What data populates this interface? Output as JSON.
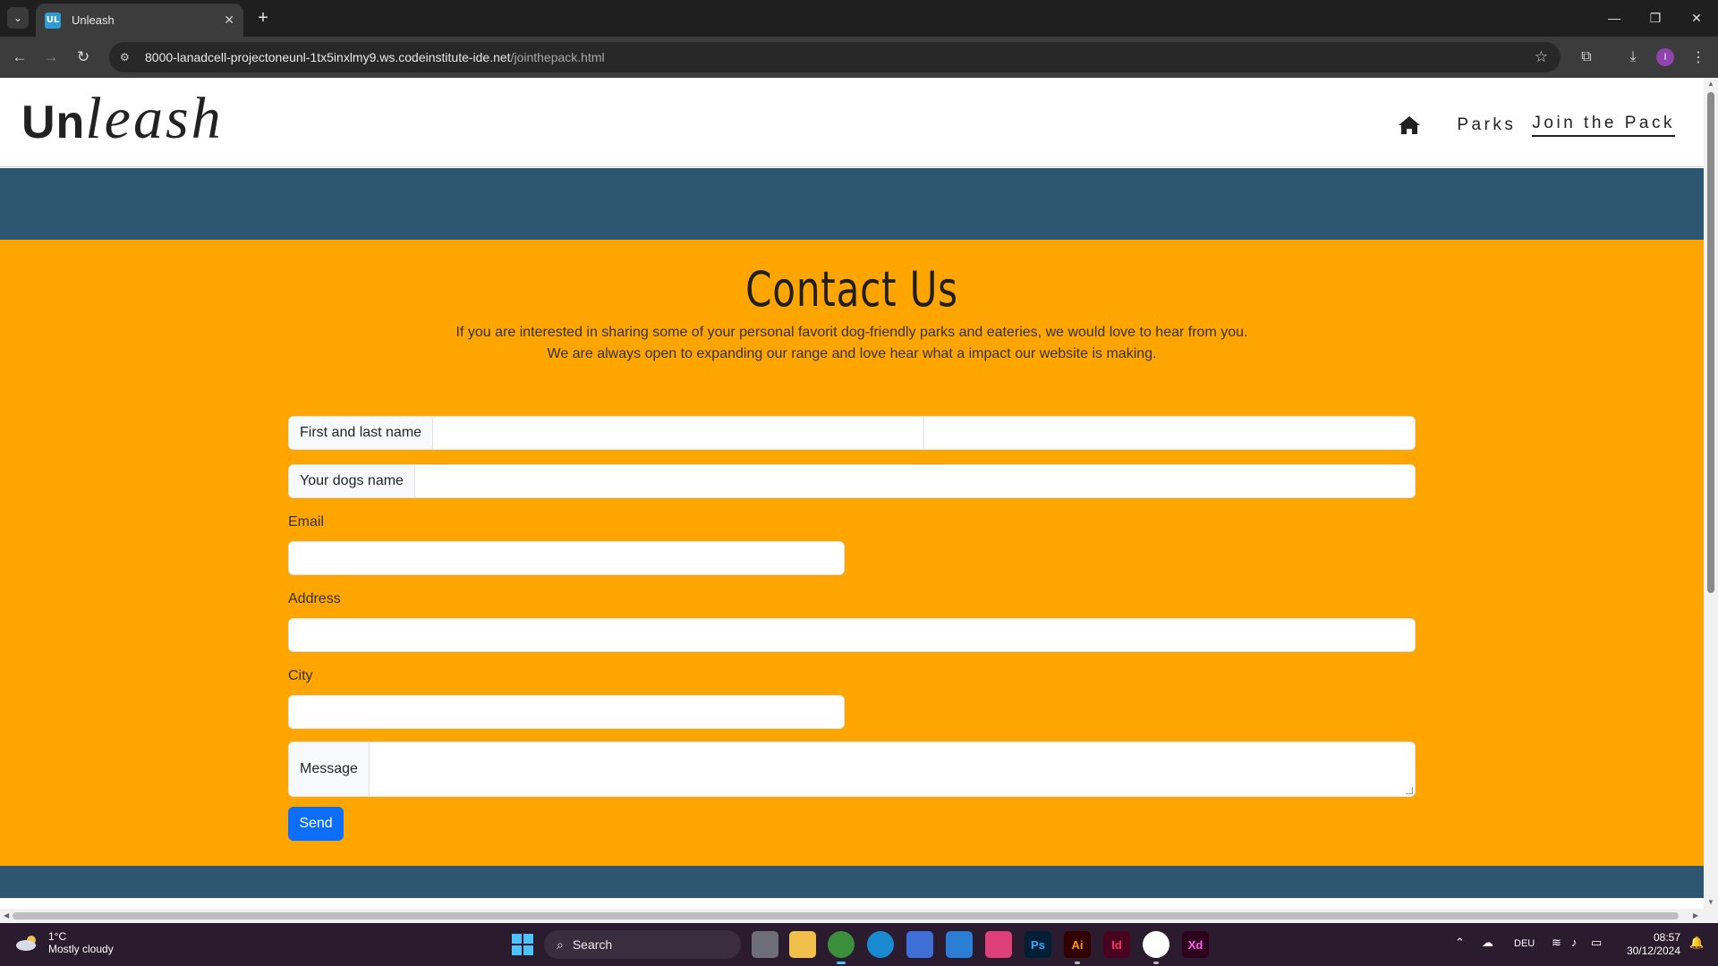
{
  "browser": {
    "tab_title": "Unleash",
    "favicon_text": "UL",
    "url_host": "8000-lanadcell-projectoneunl-1tx5inxlmy9.ws.codeinstitute-ide.net",
    "url_path": "/jointhepack.html",
    "profile_initial": "I"
  },
  "site": {
    "logo_part1": "Un",
    "logo_part2": "leash",
    "nav": {
      "parks": "Parks",
      "join": "Join the Pack"
    }
  },
  "contact": {
    "title": "Contact Us",
    "intro_line1": "If you are interested in sharing some of your personal favorit dog-friendly parks and eateries, we would love to hear from you.",
    "intro_line2": "We are always open to expanding our range and love hear what a impact our website is making.",
    "name_label": "First and last name",
    "dog_label": "Your dogs name",
    "email_label": "Email",
    "address_label": "Address",
    "city_label": "City",
    "message_label": "Message",
    "send_label": "Send"
  },
  "taskbar": {
    "weather_temp": "1°C",
    "weather_desc": "Mostly cloudy",
    "search_label": "Search",
    "language": "DEU",
    "time": "08:57",
    "date": "30/12/2024",
    "apps": [
      "task-view",
      "file-explorer",
      "chrome",
      "edge",
      "store",
      "calendar",
      "creative-cloud",
      "Ps",
      "Ai",
      "Id",
      "slack",
      "Xd"
    ]
  },
  "colors": {
    "header_band": "#2f5670",
    "contact_bg": "#ffa500",
    "send_button": "#0d6efd"
  }
}
